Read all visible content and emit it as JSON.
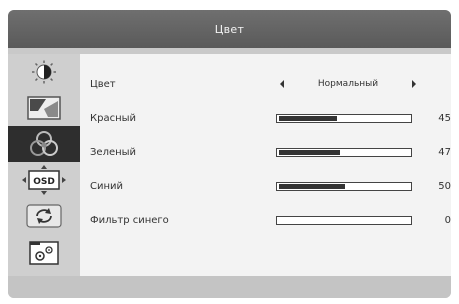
{
  "window": {
    "title": "Цвет"
  },
  "sidebar": {
    "items": [
      {
        "icon": "brightness-icon",
        "active": false
      },
      {
        "icon": "image-icon",
        "active": false
      },
      {
        "icon": "color-icon",
        "active": true
      },
      {
        "icon": "osd-icon",
        "label": "OSD",
        "active": false
      },
      {
        "icon": "reset-icon",
        "active": false
      },
      {
        "icon": "settings-icon",
        "active": false
      }
    ]
  },
  "menu": {
    "color_mode": {
      "label": "Цвет",
      "value": "Нормальный"
    },
    "red": {
      "label": "Красный",
      "value": "45"
    },
    "green": {
      "label": "Зеленый",
      "value": "47"
    },
    "blue": {
      "label": "Синий",
      "value": "50"
    },
    "blue_filter": {
      "label": "Фильтр синего",
      "value": "0"
    }
  },
  "colors": {
    "title_bg": "#5f5f5f",
    "active_item_bg": "#2e2e2e",
    "content_bg": "#f3f3f3",
    "sidebar_bg": "#cfcfcf"
  }
}
